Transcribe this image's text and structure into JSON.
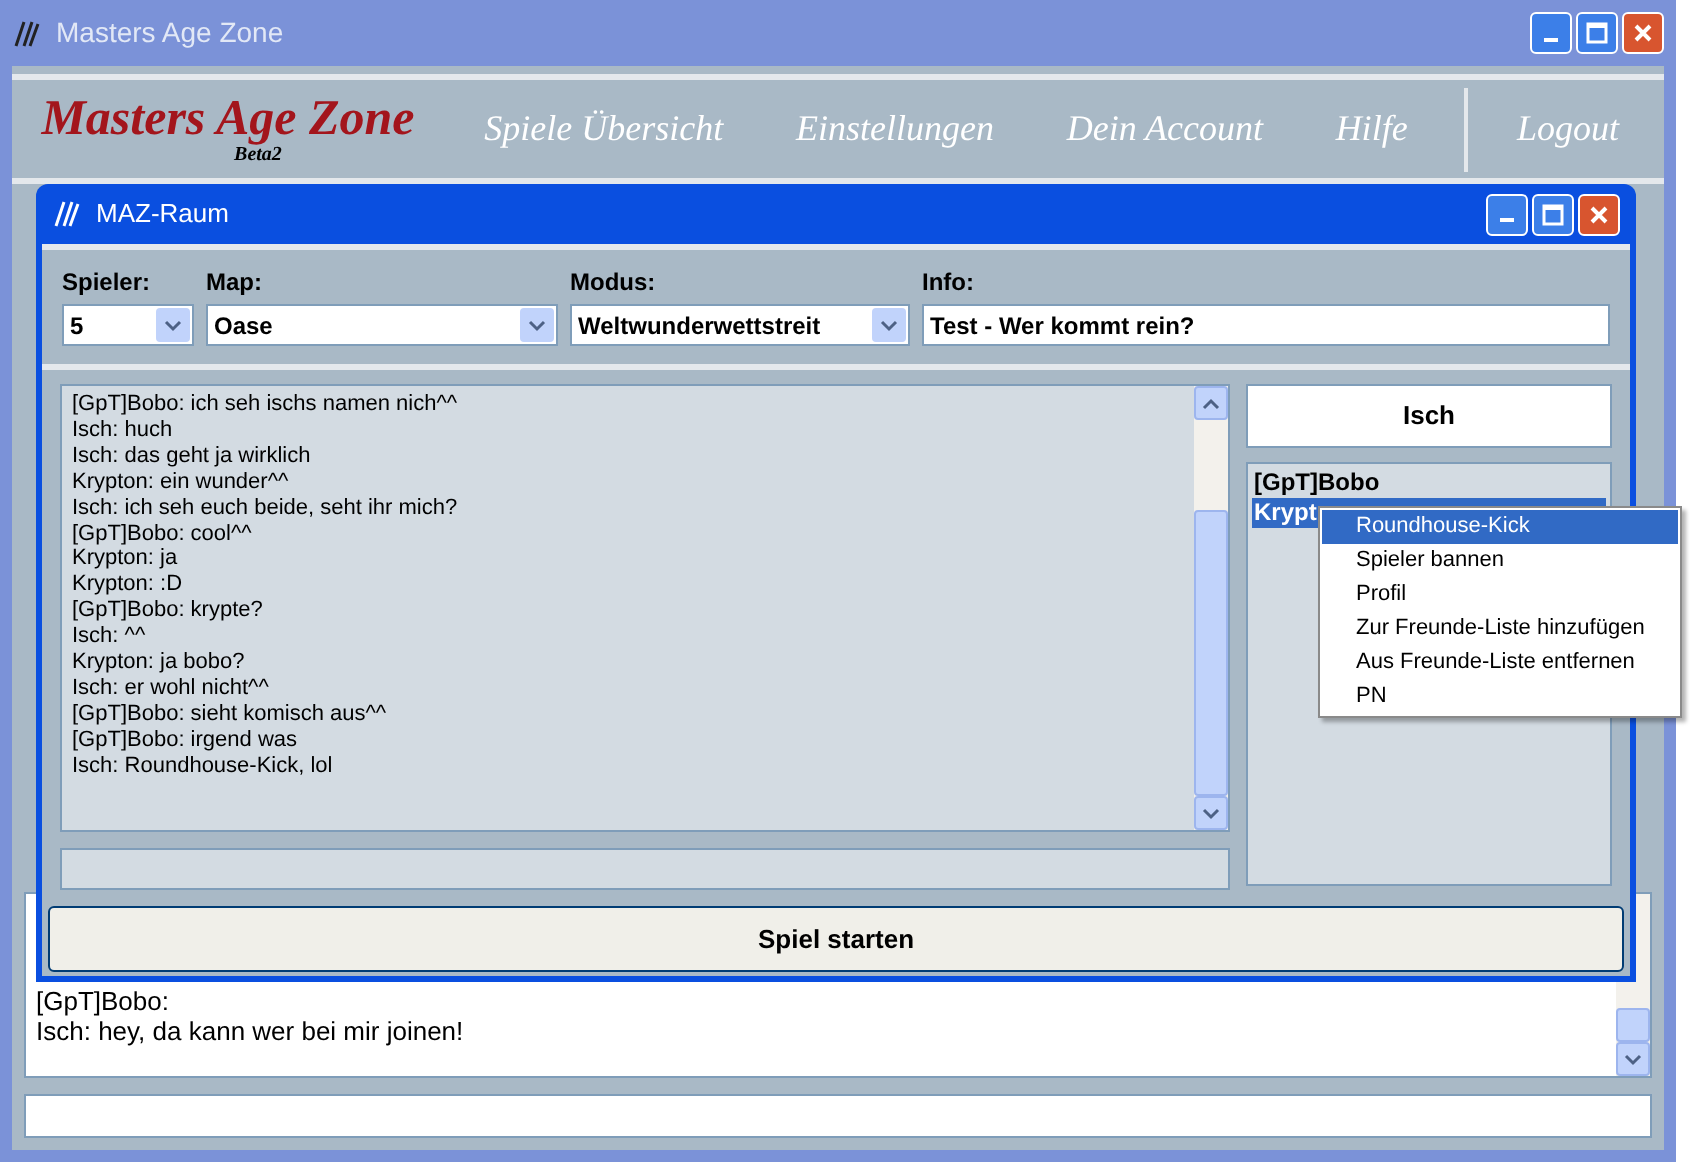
{
  "window": {
    "title": "Masters Age Zone"
  },
  "header": {
    "logo": "Masters Age Zone",
    "logo_sub": "Beta2",
    "nav": [
      "Spiele Übersicht",
      "Einstellungen",
      "Dein Account",
      "Hilfe"
    ],
    "logout": "Logout"
  },
  "lobby_chat": {
    "lines": [
      "[GpT]Bobo:",
      "Isch: hey, da kann wer bei mir joinen!"
    ]
  },
  "dialog": {
    "title": "MAZ-Raum",
    "fields": [
      {
        "label": "Spieler:",
        "value": "5",
        "kind": "select"
      },
      {
        "label": "Map:",
        "value": "Oase",
        "kind": "select"
      },
      {
        "label": "Modus:",
        "value": "Weltwunderwettstreit",
        "kind": "select"
      },
      {
        "label": "Info:",
        "value": "Test - Wer kommt rein?",
        "kind": "text"
      }
    ],
    "chat": [
      "[GpT]Bobo: ich seh ischs namen nich^^",
      "Isch: huch",
      "Isch: das geht ja wirklich",
      "Krypton: ein wunder^^",
      "Isch: ich seh euch beide, seht ihr mich?",
      "[GpT]Bobo: cool^^",
      "Krypton: ja",
      "Krypton: :D",
      "[GpT]Bobo: krypte?",
      "Isch: ^^",
      "Krypton: ja bobo?",
      "Isch: er wohl nicht^^",
      "[GpT]Bobo: sieht komisch aus^^",
      "[GpT]Bobo: irgend was",
      "Isch: Roundhouse-Kick, lol"
    ],
    "player_name": "Isch",
    "players": [
      {
        "name": "[GpT]Bobo",
        "selected": false
      },
      {
        "name": "Krypt",
        "selected": true
      }
    ],
    "start_button": "Spiel starten"
  },
  "context_menu": [
    {
      "label": "Roundhouse-Kick",
      "selected": true
    },
    {
      "label": "Spieler bannen",
      "selected": false
    },
    {
      "label": "Profil",
      "selected": false
    },
    {
      "label": "Zur Freunde-Liste hinzufügen",
      "selected": false
    },
    {
      "label": "Aus Freunde-Liste entfernen",
      "selected": false
    },
    {
      "label": "PN",
      "selected": false
    }
  ]
}
